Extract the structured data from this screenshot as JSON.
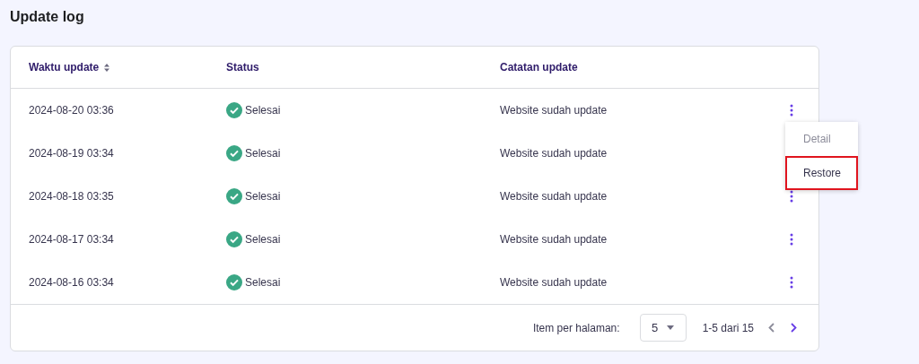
{
  "page_title": "Update log",
  "table": {
    "columns": [
      {
        "label": "Waktu update",
        "kind": "sortable"
      },
      {
        "label": "Status",
        "kind": "plain"
      },
      {
        "label": "Catatan update",
        "kind": "plain"
      }
    ],
    "rows": [
      {
        "time": "2024-08-20 03:36",
        "status": "Selesai",
        "note": "Website sudah update",
        "menu_open": true
      },
      {
        "time": "2024-08-19 03:34",
        "status": "Selesai",
        "note": "Website sudah update"
      },
      {
        "time": "2024-08-18 03:35",
        "status": "Selesai",
        "note": "Website sudah update"
      },
      {
        "time": "2024-08-17 03:34",
        "status": "Selesai",
        "note": "Website sudah update"
      },
      {
        "time": "2024-08-16 03:34",
        "status": "Selesai",
        "note": "Website sudah update"
      }
    ]
  },
  "row_menu": {
    "items": [
      {
        "label": "Detail",
        "disabled": true,
        "highlighted": false
      },
      {
        "label": "Restore",
        "disabled": false,
        "highlighted": true
      }
    ]
  },
  "pagination": {
    "per_page_label": "Item per halaman:",
    "per_page": "5",
    "range": "1-5 dari 15",
    "prev_disabled": true,
    "next_disabled": false
  }
}
